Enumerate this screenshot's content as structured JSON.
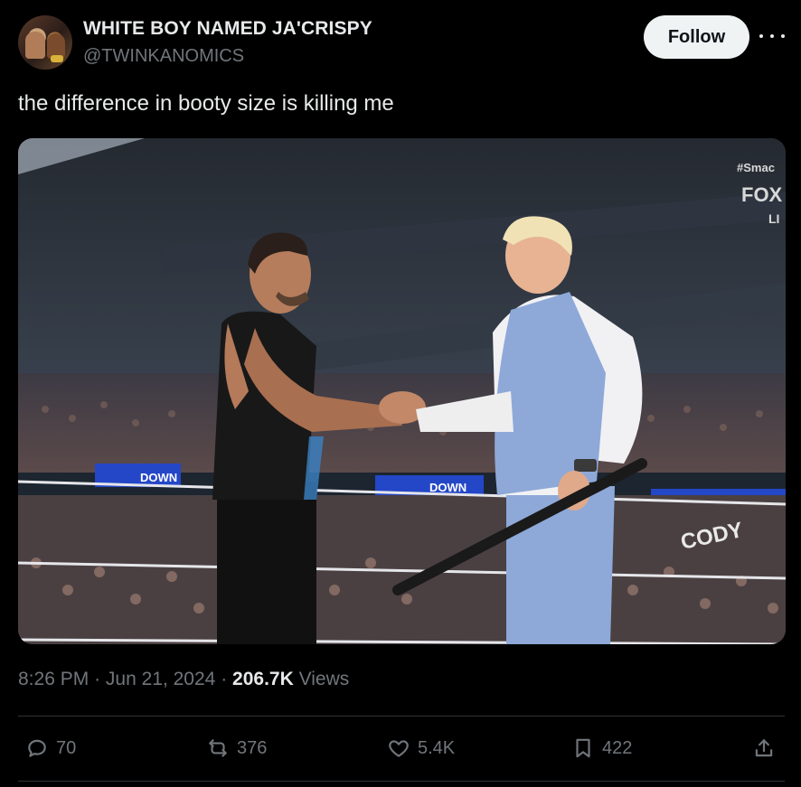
{
  "author": {
    "display_name": "WHITE BOY NAMED JA'CRISPY",
    "handle": "@TWINKANOMICS"
  },
  "follow_label": "Follow",
  "tweet_text": "the difference in booty size is killing me",
  "media": {
    "overlay_hashtag": "#Smac",
    "overlay_network": "FOX",
    "overlay_live": "LI",
    "banner_text": "DOWN",
    "sign_text": "CODY"
  },
  "meta": {
    "time": "8:26 PM",
    "date": "Jun 21, 2024",
    "separator": "·",
    "views_count": "206.7K",
    "views_label": "Views"
  },
  "actions": {
    "replies": "70",
    "reposts": "376",
    "likes": "5.4K",
    "bookmarks": "422"
  },
  "icons": [
    "more-icon",
    "reply-icon",
    "repost-icon",
    "like-icon",
    "bookmark-icon",
    "share-icon"
  ],
  "colors": {
    "background": "#000000",
    "text": "#e7e9ea",
    "muted": "#71767b",
    "follow_bg": "#eff3f4",
    "divider": "#2f3336"
  }
}
